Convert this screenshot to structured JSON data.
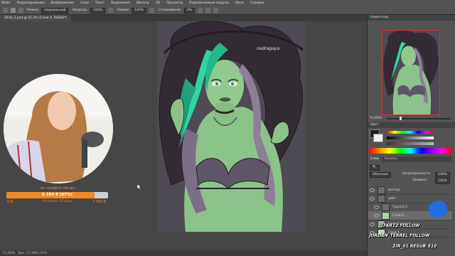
{
  "menu": [
    "Файл",
    "Редактирование",
    "Изображение",
    "Слои",
    "Текст",
    "Выделение",
    "Фильтр",
    "3D",
    "Просмотр",
    "Подключаемые модули",
    "Окно",
    "Справка"
  ],
  "options": {
    "mode_label": "Режим:",
    "mode_value": "Нормальный",
    "opacity_label": "Непрозр.:",
    "opacity_value": "100%",
    "flow_label": "Нажим:",
    "flow_value": "100%",
    "smoothing_label": "Сглаживание:",
    "smoothing_value": "0%"
  },
  "document_tab": "2910_2.psd @ 51,5% (Слой 4, RGB/8*)",
  "artwork": {
    "signature": "nadragaya",
    "background": "#4e4b55",
    "hair_color": "#2fd6a0",
    "skin_color": "#8cc38a"
  },
  "status": {
    "zoom": "51,69%",
    "doc_size": "Док: 17,4M/1,07G"
  },
  "navigator": {
    "title": "Навигатор",
    "zoom": "51,69%"
  },
  "color_panel": {
    "title": "Цвет"
  },
  "layers_panel": {
    "tabs": [
      "Слои",
      "Каналы"
    ],
    "blend_mode": "Обычные",
    "opacity_label": "Непрозрачность:",
    "opacity_value": "100%",
    "fill_label": "Заливка:",
    "fill_value": "100%",
    "layers": [
      {
        "name": "контур"
      },
      {
        "name": "цвет"
      },
      {
        "name": "Группа 1"
      },
      {
        "name": "Слой 6"
      },
      {
        "name": "Слой 1 копия"
      },
      {
        "name": "Слой 1"
      }
    ]
  },
  "webcam": {
    "description_hidden": true
  },
  "donation": {
    "title": "на телефон Наташ",
    "amount": "6 100 ₽ (87%)",
    "progress": 0.87,
    "min": "0 ₽",
    "remaining": "Осталось 37 день",
    "max": "7 000 ₽",
    "accent": "#f08a1e"
  },
  "overlay": {
    "follow_line1": "1FAR12   FOLLOW",
    "follow_line2": "JORDAN_TERREL   FOLLOW",
    "resub_line": "ZIR_01   RESUB X10"
  }
}
